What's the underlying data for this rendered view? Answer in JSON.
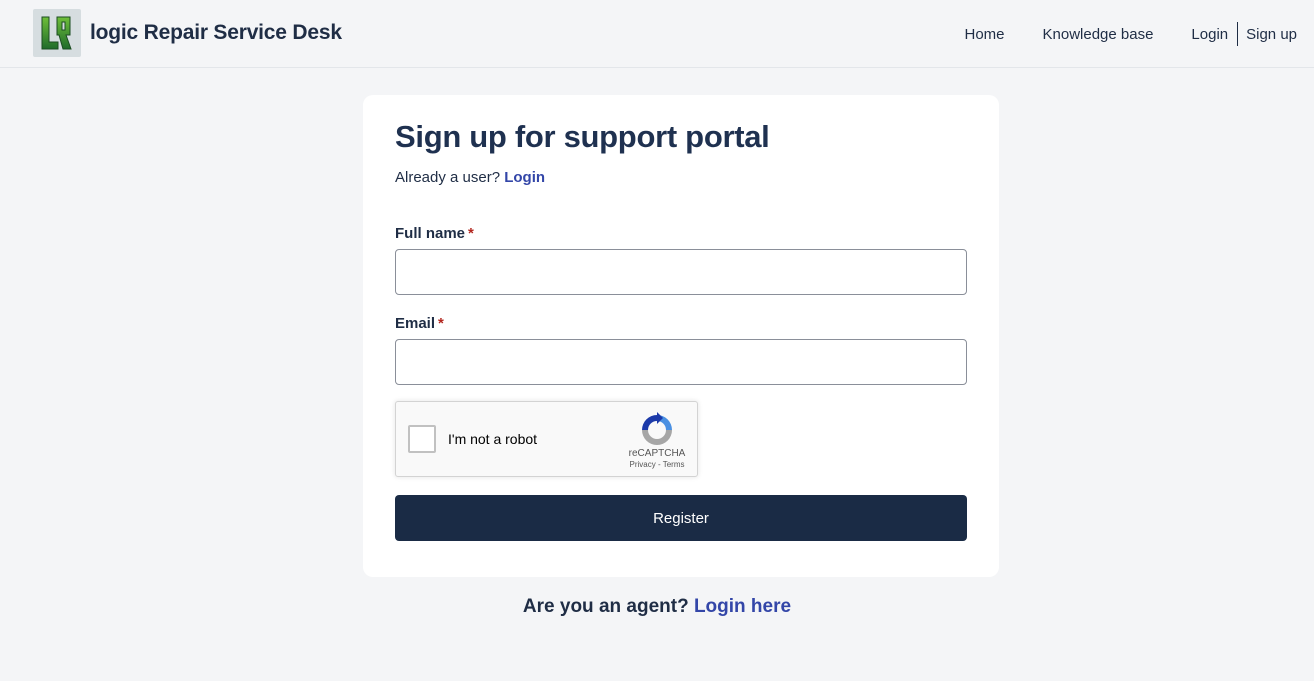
{
  "header": {
    "brand_title": "logic Repair Service Desk",
    "logo_icon": "lr-logo-icon",
    "nav": {
      "home": "Home",
      "knowledge_base": "Knowledge base",
      "login": "Login",
      "signup": "Sign up"
    }
  },
  "form": {
    "title": "Sign up for support portal",
    "already_text": "Already a user?",
    "login_link": "Login",
    "full_name_label": "Full name",
    "full_name_value": "",
    "email_label": "Email",
    "email_value": "",
    "required_marker": "*",
    "register_label": "Register"
  },
  "recaptcha": {
    "label": "I'm not a robot",
    "brand": "reCAPTCHA",
    "privacy": "Privacy",
    "separator": " - ",
    "terms": "Terms"
  },
  "agent": {
    "question": "Are you an agent?",
    "link": "Login here"
  },
  "colors": {
    "primary_dark": "#1a2b45",
    "link_blue": "#3346a8",
    "required_red": "#b3261e",
    "background": "#f4f5f7"
  }
}
